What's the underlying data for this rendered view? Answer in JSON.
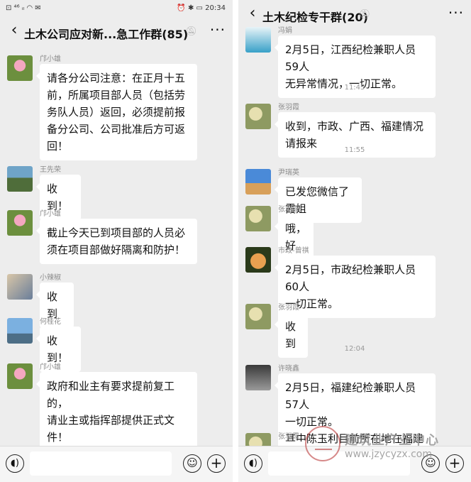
{
  "left": {
    "statusbar": {
      "left": "⊡ ⁴⁶ ᵢₗ ◠ ✉",
      "right": "⏰ ✱ ▭ 20:34"
    },
    "title": "土木公司应对新...急工作群(85)",
    "icons": {
      "back": "chevron-left-icon",
      "mute": "bell-muted-icon",
      "more": "more-dots-icon"
    },
    "messages": [
      {
        "sender": "邝小雄",
        "text": "请各分公司注意：在正月十五\n前，所属项目部人员（包括劳\n务队人员）返回，必须提前报\n备分公司、公司批准后方可返\n回！"
      },
      {
        "sender": "王先荣",
        "text": "收到！"
      },
      {
        "sender": "邝小雄",
        "text": "截止今天已到项目部的人员必\n须在项目部做好隔离和防护！"
      },
      {
        "sender": "小辣椒",
        "text": "收到"
      },
      {
        "sender": "何桂花",
        "text": "收到！"
      },
      {
        "sender": "邝小雄",
        "text": "政府和业主有要求提前复工的，\n请业主或指挥部提供正式文\n件！"
      }
    ]
  },
  "right": {
    "title": "土木纪检专干群(20)",
    "icons": {
      "back": "chevron-left-icon",
      "mute": "bell-muted-icon",
      "more": "more-dots-icon"
    },
    "items": [
      {
        "kind": "msg",
        "sender": "冯娟",
        "text": "2月5日，江西纪检兼职人员59人\n无异常情况，一切正常。"
      },
      {
        "kind": "time",
        "text": "11:45"
      },
      {
        "kind": "msg",
        "sender": "张羽霞",
        "text": "收到，市政、广西、福建情况请报来"
      },
      {
        "kind": "time",
        "text": "11:55"
      },
      {
        "kind": "msg",
        "sender": "尹瑞英",
        "text": "已发您微信了霞姐"
      },
      {
        "kind": "msg",
        "sender": "张羽霞",
        "text": "哦，好"
      },
      {
        "kind": "msg",
        "sender": "市政-曾祺",
        "text": "2月5日，市政纪检兼职人员60人\n一切正常。"
      },
      {
        "kind": "msg",
        "sender": "张羽霞",
        "text": "收到"
      },
      {
        "kind": "time",
        "text": "12:04"
      },
      {
        "kind": "msg",
        "sender": "许晓鑫",
        "text": "2月5日，福建纪检兼职人员57人\n一切正常。\n其中陈玉利目前所在地在福建福州"
      },
      {
        "kind": "msg",
        "sender": "张羽霞",
        "text": ""
      }
    ]
  },
  "inputbar": {
    "voice_icon": "voice-icon",
    "emoji_icon": "emoji-icon",
    "plus_icon": "plus-icon"
  },
  "watermark": {
    "name": "建筑业产业中心",
    "url": "www.jzycyzx.com"
  },
  "colors": {
    "chat_bg": "#ededed",
    "bubble": "#ffffff",
    "sender": "#8c8c8c",
    "watermark": "#969696"
  }
}
